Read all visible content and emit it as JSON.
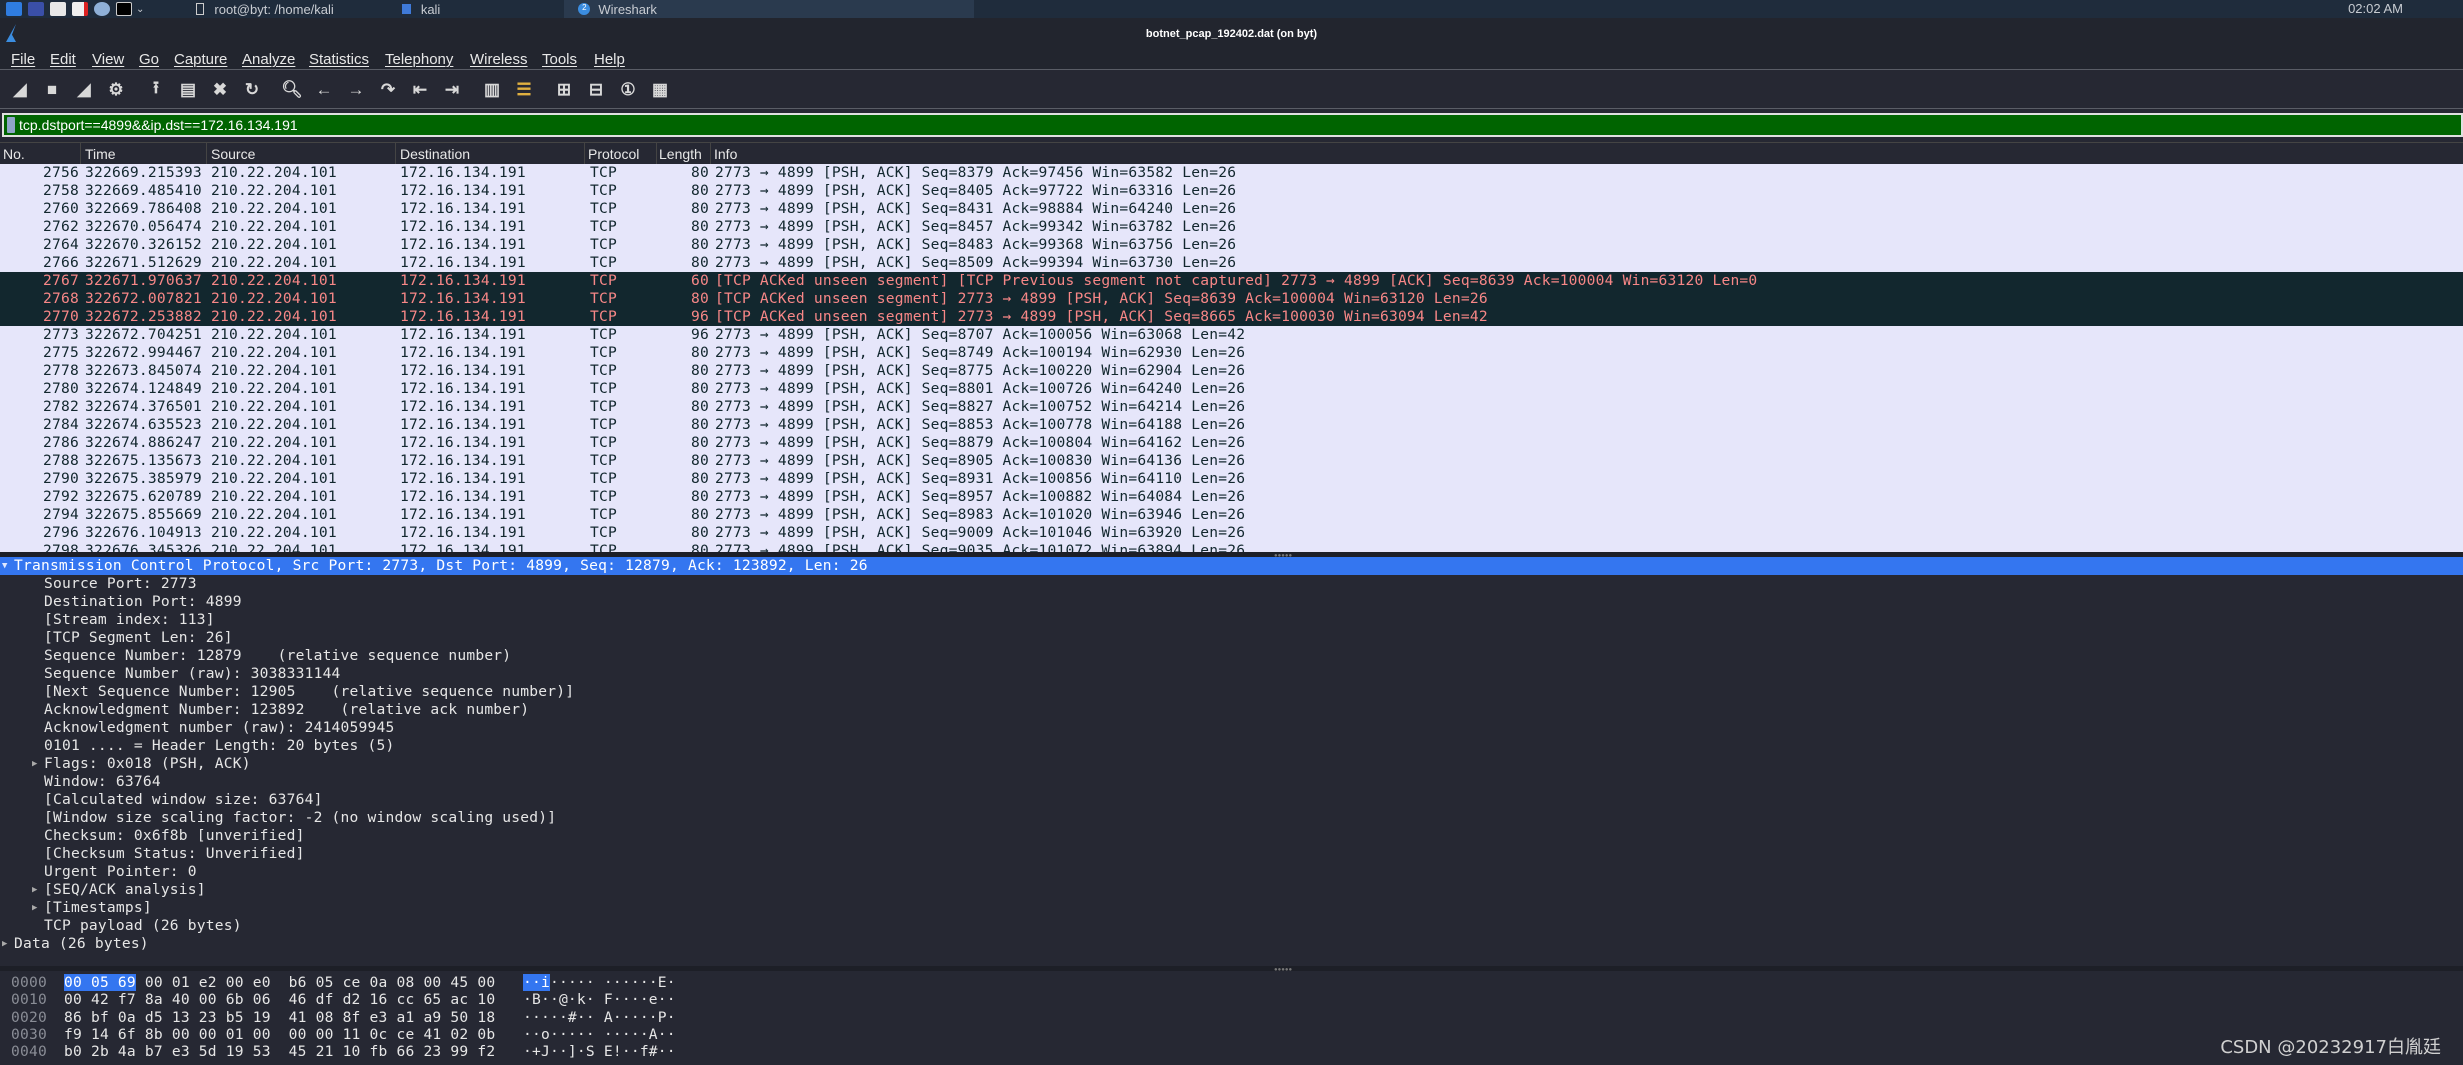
{
  "taskbar": {
    "tasks": [
      "root@byt: /home/kali",
      "kali",
      "Wireshark"
    ],
    "wireshark_badge": "2",
    "clock": "02:02 AM"
  },
  "window": {
    "title": "botnet_pcap_192402.dat (on byt)"
  },
  "menu": [
    "File",
    "Edit",
    "View",
    "Go",
    "Capture",
    "Analyze",
    "Statistics",
    "Telephony",
    "Wireless",
    "Tools",
    "Help"
  ],
  "toolbar": [
    "start-capture-icon",
    "stop-capture-icon",
    "restart-capture-icon",
    "capture-options-icon",
    "open-file-icon",
    "save-file-icon",
    "close-file-icon",
    "reload-file-icon",
    "find-packet-icon",
    "go-back-icon",
    "go-forward-icon",
    "go-to-packet-icon",
    "first-packet-icon",
    "last-packet-icon",
    "autoscroll-icon",
    "colorize-icon",
    "zoom-in-icon",
    "zoom-out-icon",
    "normal-size-icon",
    "resize-columns-icon"
  ],
  "filter": {
    "value": "tcp.dstport==4899&&ip.dst==172.16.134.191"
  },
  "columns": [
    "No.",
    "Time",
    "Source",
    "Destination",
    "Protocol",
    "Length",
    "Info"
  ],
  "colors": {
    "filter_valid": "#006400",
    "row_normal_bg": "#e6e6fa",
    "row_bad_bg": "#12272e",
    "row_bad_fg": "#f78787",
    "selection": "#3476f0"
  },
  "packets": [
    [
      "2756",
      "322669.215393",
      "210.22.204.101",
      "172.16.134.191",
      "TCP",
      "80",
      "2773 → 4899 [PSH, ACK] Seq=8379 Ack=97456 Win=63582 Len=26",
      "normal"
    ],
    [
      "2758",
      "322669.485410",
      "210.22.204.101",
      "172.16.134.191",
      "TCP",
      "80",
      "2773 → 4899 [PSH, ACK] Seq=8405 Ack=97722 Win=63316 Len=26",
      "normal"
    ],
    [
      "2760",
      "322669.786408",
      "210.22.204.101",
      "172.16.134.191",
      "TCP",
      "80",
      "2773 → 4899 [PSH, ACK] Seq=8431 Ack=98884 Win=64240 Len=26",
      "normal"
    ],
    [
      "2762",
      "322670.056474",
      "210.22.204.101",
      "172.16.134.191",
      "TCP",
      "80",
      "2773 → 4899 [PSH, ACK] Seq=8457 Ack=99342 Win=63782 Len=26",
      "normal"
    ],
    [
      "2764",
      "322670.326152",
      "210.22.204.101",
      "172.16.134.191",
      "TCP",
      "80",
      "2773 → 4899 [PSH, ACK] Seq=8483 Ack=99368 Win=63756 Len=26",
      "normal"
    ],
    [
      "2766",
      "322671.512629",
      "210.22.204.101",
      "172.16.134.191",
      "TCP",
      "80",
      "2773 → 4899 [PSH, ACK] Seq=8509 Ack=99394 Win=63730 Len=26",
      "normal"
    ],
    [
      "2767",
      "322671.970637",
      "210.22.204.101",
      "172.16.134.191",
      "TCP",
      "60",
      "[TCP ACKed unseen segment] [TCP Previous segment not captured] 2773 → 4899 [ACK] Seq=8639 Ack=100004 Win=63120 Len=0",
      "bad"
    ],
    [
      "2768",
      "322672.007821",
      "210.22.204.101",
      "172.16.134.191",
      "TCP",
      "80",
      "[TCP ACKed unseen segment] 2773 → 4899 [PSH, ACK] Seq=8639 Ack=100004 Win=63120 Len=26",
      "bad"
    ],
    [
      "2770",
      "322672.253882",
      "210.22.204.101",
      "172.16.134.191",
      "TCP",
      "96",
      "[TCP ACKed unseen segment] 2773 → 4899 [PSH, ACK] Seq=8665 Ack=100030 Win=63094 Len=42",
      "bad"
    ],
    [
      "2773",
      "322672.704251",
      "210.22.204.101",
      "172.16.134.191",
      "TCP",
      "96",
      "2773 → 4899 [PSH, ACK] Seq=8707 Ack=100056 Win=63068 Len=42",
      "normal"
    ],
    [
      "2775",
      "322672.994467",
      "210.22.204.101",
      "172.16.134.191",
      "TCP",
      "80",
      "2773 → 4899 [PSH, ACK] Seq=8749 Ack=100194 Win=62930 Len=26",
      "normal"
    ],
    [
      "2778",
      "322673.845074",
      "210.22.204.101",
      "172.16.134.191",
      "TCP",
      "80",
      "2773 → 4899 [PSH, ACK] Seq=8775 Ack=100220 Win=62904 Len=26",
      "normal"
    ],
    [
      "2780",
      "322674.124849",
      "210.22.204.101",
      "172.16.134.191",
      "TCP",
      "80",
      "2773 → 4899 [PSH, ACK] Seq=8801 Ack=100726 Win=64240 Len=26",
      "normal"
    ],
    [
      "2782",
      "322674.376501",
      "210.22.204.101",
      "172.16.134.191",
      "TCP",
      "80",
      "2773 → 4899 [PSH, ACK] Seq=8827 Ack=100752 Win=64214 Len=26",
      "normal"
    ],
    [
      "2784",
      "322674.635523",
      "210.22.204.101",
      "172.16.134.191",
      "TCP",
      "80",
      "2773 → 4899 [PSH, ACK] Seq=8853 Ack=100778 Win=64188 Len=26",
      "normal"
    ],
    [
      "2786",
      "322674.886247",
      "210.22.204.101",
      "172.16.134.191",
      "TCP",
      "80",
      "2773 → 4899 [PSH, ACK] Seq=8879 Ack=100804 Win=64162 Len=26",
      "normal"
    ],
    [
      "2788",
      "322675.135673",
      "210.22.204.101",
      "172.16.134.191",
      "TCP",
      "80",
      "2773 → 4899 [PSH, ACK] Seq=8905 Ack=100830 Win=64136 Len=26",
      "normal"
    ],
    [
      "2790",
      "322675.385979",
      "210.22.204.101",
      "172.16.134.191",
      "TCP",
      "80",
      "2773 → 4899 [PSH, ACK] Seq=8931 Ack=100856 Win=64110 Len=26",
      "normal"
    ],
    [
      "2792",
      "322675.620789",
      "210.22.204.101",
      "172.16.134.191",
      "TCP",
      "80",
      "2773 → 4899 [PSH, ACK] Seq=8957 Ack=100882 Win=64084 Len=26",
      "normal"
    ],
    [
      "2794",
      "322675.855669",
      "210.22.204.101",
      "172.16.134.191",
      "TCP",
      "80",
      "2773 → 4899 [PSH, ACK] Seq=8983 Ack=101020 Win=63946 Len=26",
      "normal"
    ],
    [
      "2796",
      "322676.104913",
      "210.22.204.101",
      "172.16.134.191",
      "TCP",
      "80",
      "2773 → 4899 [PSH, ACK] Seq=9009 Ack=101046 Win=63920 Len=26",
      "normal"
    ],
    [
      "2798",
      "322676.345326",
      "210.22.204.101",
      "172.16.134.191",
      "TCP",
      "80",
      "2773 → 4899 [PSH, ACK] Seq=9035 Ack=101072 Win=63894 Len=26",
      "normal"
    ]
  ],
  "details": [
    {
      "text": "Transmission Control Protocol, Src Port: 2773, Dst Port: 4899, Seq: 12879, Ack: 123892, Len: 26",
      "level": 0,
      "expander": "expanded",
      "selected": true
    },
    {
      "text": "Source Port: 2773",
      "level": 1
    },
    {
      "text": "Destination Port: 4899",
      "level": 1
    },
    {
      "text": "[Stream index: 113]",
      "level": 1
    },
    {
      "text": "[TCP Segment Len: 26]",
      "level": 1
    },
    {
      "text": "Sequence Number: 12879    (relative sequence number)",
      "level": 1
    },
    {
      "text": "Sequence Number (raw): 3038331144",
      "level": 1
    },
    {
      "text": "[Next Sequence Number: 12905    (relative sequence number)]",
      "level": 1
    },
    {
      "text": "Acknowledgment Number: 123892    (relative ack number)",
      "level": 1
    },
    {
      "text": "Acknowledgment number (raw): 2414059945",
      "level": 1
    },
    {
      "text": "0101 .... = Header Length: 20 bytes (5)",
      "level": 1
    },
    {
      "text": "Flags: 0x018 (PSH, ACK)",
      "level": 1,
      "expander": "collapsed"
    },
    {
      "text": "Window: 63764",
      "level": 1
    },
    {
      "text": "[Calculated window size: 63764]",
      "level": 1
    },
    {
      "text": "[Window size scaling factor: -2 (no window scaling used)]",
      "level": 1
    },
    {
      "text": "Checksum: 0x6f8b [unverified]",
      "level": 1
    },
    {
      "text": "[Checksum Status: Unverified]",
      "level": 1
    },
    {
      "text": "Urgent Pointer: 0",
      "level": 1
    },
    {
      "text": "[SEQ/ACK analysis]",
      "level": 1,
      "expander": "collapsed"
    },
    {
      "text": "[Timestamps]",
      "level": 1,
      "expander": "collapsed"
    },
    {
      "text": "TCP payload (26 bytes)",
      "level": 1
    },
    {
      "text": "Data (26 bytes)",
      "level": 0,
      "expander": "collapsed"
    }
  ],
  "hex": [
    {
      "offset": "0000",
      "hl_bytes": "00 05 69",
      "bytes": " 00 01 e2 00 e0  b6 05 ce 0a 08 00 45 00",
      "hl_ascii": "··i",
      "ascii": "····· ······E·"
    },
    {
      "offset": "0010",
      "hl_bytes": "",
      "bytes": "00 42 f7 8a 40 00 6b 06  46 df d2 16 cc 65 ac 10",
      "hl_ascii": "",
      "ascii": "·B··@·k· F····e··"
    },
    {
      "offset": "0020",
      "hl_bytes": "",
      "bytes": "86 bf 0a d5 13 23 b5 19  41 08 8f e3 a1 a9 50 18",
      "hl_ascii": "",
      "ascii": "·····#·· A·····P·"
    },
    {
      "offset": "0030",
      "hl_bytes": "",
      "bytes": "f9 14 6f 8b 00 00 01 00  00 00 11 0c ce 41 02 0b",
      "hl_ascii": "",
      "ascii": "··o····· ·····A··"
    },
    {
      "offset": "0040",
      "hl_bytes": "",
      "bytes": "b0 2b 4a b7 e3 5d 19 53  45 21 10 fb 66 23 99 f2",
      "hl_ascii": "",
      "ascii": "·+J··]·S E!··f#··"
    }
  ],
  "watermark": "CSDN @20232917白胤廷"
}
